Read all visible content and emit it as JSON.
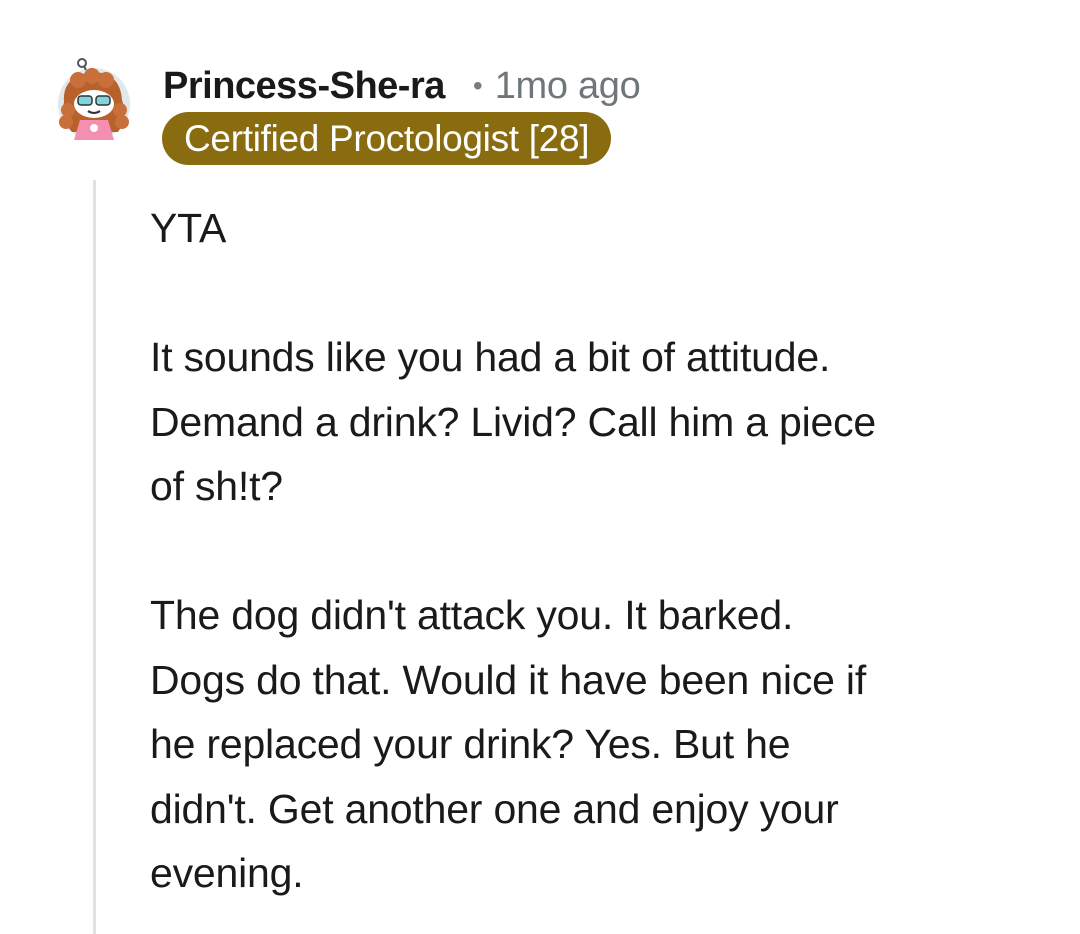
{
  "comment": {
    "username": "Princess-She-ra",
    "separator": "•",
    "timestamp": "1mo ago",
    "flair": "Certified Proctologist [28]",
    "flair_color": "#8a6c10",
    "avatar_icon": "snoo-avatar-icon",
    "paragraphs": [
      {
        "lines": [
          "YTA"
        ]
      },
      {
        "lines": [
          "It sounds like you had a bit of attitude.",
          "Demand a drink? Livid? Call him a piece",
          "of sh!t?"
        ]
      },
      {
        "lines": [
          "The dog didn't attack you. It barked.",
          "Dogs do that. Would it have been nice if",
          "he replaced your drink? Yes. But he",
          "didn't. Get another one and enjoy your",
          "evening."
        ]
      }
    ]
  }
}
